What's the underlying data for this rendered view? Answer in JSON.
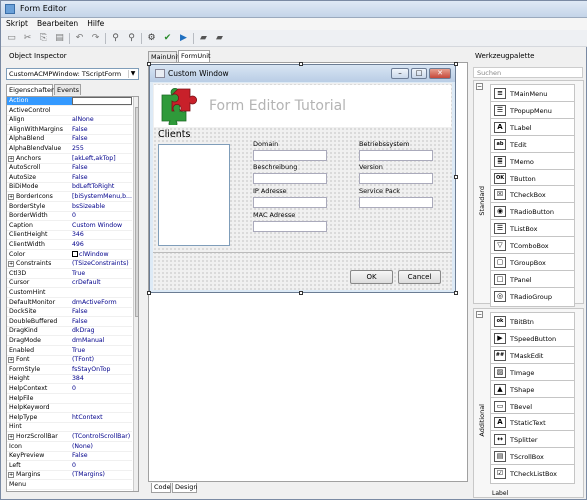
{
  "app": {
    "title": "Form Editor"
  },
  "menu": [
    "Skript",
    "Bearbeiten",
    "Hilfe"
  ],
  "toolbar_icons": [
    "new-icon",
    "cut-icon",
    "copy-icon",
    "paste-icon",
    "undo-icon",
    "redo-icon",
    "find-icon",
    "replace-icon",
    "compile-icon",
    "check-icon",
    "run-icon",
    "open-icon",
    "save-icon"
  ],
  "inspector": {
    "title": "Object Inspector",
    "combo": "CustomACMPWindow: TScriptForm",
    "tabs": [
      "Eigenschaften",
      "Events"
    ],
    "rows": [
      {
        "k": "Action",
        "v": "",
        "sel": true
      },
      {
        "k": "ActiveControl",
        "v": ""
      },
      {
        "k": "Align",
        "v": "alNone"
      },
      {
        "k": "AlignWithMargins",
        "v": "False"
      },
      {
        "k": "AlphaBlend",
        "v": "False"
      },
      {
        "k": "AlphaBlendValue",
        "v": "255"
      },
      {
        "k": "Anchors",
        "v": "[akLeft,akTop]",
        "plus": true
      },
      {
        "k": "AutoScroll",
        "v": "False"
      },
      {
        "k": "AutoSize",
        "v": "False"
      },
      {
        "k": "BiDiMode",
        "v": "bdLeftToRight"
      },
      {
        "k": "BorderIcons",
        "v": "[biSystemMenu,b...",
        "plus": true
      },
      {
        "k": "BorderStyle",
        "v": "bsSizeable"
      },
      {
        "k": "BorderWidth",
        "v": "0"
      },
      {
        "k": "Caption",
        "v": "Custom Window"
      },
      {
        "k": "ClientHeight",
        "v": "346"
      },
      {
        "k": "ClientWidth",
        "v": "496"
      },
      {
        "k": "Color",
        "v": "clWindow",
        "swatch": true
      },
      {
        "k": "Constraints",
        "v": "(TSizeConstraints)",
        "plus": true
      },
      {
        "k": "Ctl3D",
        "v": "True"
      },
      {
        "k": "Cursor",
        "v": "crDefault"
      },
      {
        "k": "CustomHint",
        "v": ""
      },
      {
        "k": "DefaultMonitor",
        "v": "dmActiveForm"
      },
      {
        "k": "DockSite",
        "v": "False"
      },
      {
        "k": "DoubleBuffered",
        "v": "False"
      },
      {
        "k": "DragKind",
        "v": "dkDrag"
      },
      {
        "k": "DragMode",
        "v": "dmManual"
      },
      {
        "k": "Enabled",
        "v": "True"
      },
      {
        "k": "Font",
        "v": "(TFont)",
        "plus": true
      },
      {
        "k": "FormStyle",
        "v": "fsStayOnTop"
      },
      {
        "k": "Height",
        "v": "384"
      },
      {
        "k": "HelpContext",
        "v": "0"
      },
      {
        "k": "HelpFile",
        "v": ""
      },
      {
        "k": "HelpKeyword",
        "v": ""
      },
      {
        "k": "HelpType",
        "v": "htContext"
      },
      {
        "k": "Hint",
        "v": ""
      },
      {
        "k": "HorzScrollBar",
        "v": "(TControlScrollBar)",
        "plus": true
      },
      {
        "k": "Icon",
        "v": "(None)"
      },
      {
        "k": "KeyPreview",
        "v": "False"
      },
      {
        "k": "Left",
        "v": "0"
      },
      {
        "k": "Margins",
        "v": "(TMargins)",
        "plus": true
      },
      {
        "k": "Menu",
        "v": ""
      }
    ]
  },
  "editor": {
    "tabs": [
      "MainUnit",
      "FormUnit"
    ],
    "bottom_tabs": [
      "Code",
      "Design"
    ],
    "form": {
      "caption": "Custom Window",
      "header_title": "Form Editor Tutorial",
      "clients_label": "Clients",
      "labels": {
        "domain": "Domain",
        "betriebssystem": "Betriebssystem",
        "beschreibung": "Beschreibung",
        "version": "Version",
        "ip": "IP Adresse",
        "servicepack": "Service Pack",
        "mac": "MAC Adresse"
      },
      "ok": "OK",
      "cancel": "Cancel",
      "buttons": {
        "min": "–",
        "max": "□",
        "close": "✕"
      }
    }
  },
  "palette": {
    "title": "Werkzeugpalette",
    "search_placeholder": "Suchen",
    "groups": [
      {
        "name": "Standard",
        "items": [
          "TMainMenu",
          "TPopupMenu",
          "TLabel",
          "TEdit",
          "TMemo",
          "TButton",
          "TCheckBox",
          "TRadioButton",
          "TListBox",
          "TComboBox",
          "TGroupBox",
          "TPanel",
          "TRadioGroup"
        ],
        "icons": [
          "main-menu-icon",
          "popup-menu-icon",
          "label-icon",
          "edit-icon",
          "memo-icon",
          "button-icon",
          "checkbox-icon",
          "radio-button-icon",
          "listbox-icon",
          "combobox-icon",
          "groupbox-icon",
          "panel-icon",
          "radio-group-icon"
        ],
        "glyphs": [
          "≡",
          "☰",
          "A",
          "ab",
          "≣",
          "OK",
          "☒",
          "◉",
          "☰",
          "▽",
          "▢",
          "□",
          "◎"
        ]
      },
      {
        "name": "Additional",
        "items": [
          "TBitBtn",
          "TSpeedButton",
          "TMaskEdit",
          "TImage",
          "TShape",
          "TBevel",
          "TStaticText",
          "TSplitter",
          "TScrollBox",
          "TCheckListBox"
        ],
        "icons": [
          "bitbtn-icon",
          "speed-button-icon",
          "mask-edit-icon",
          "image-icon",
          "shape-icon",
          "bevel-icon",
          "static-text-icon",
          "splitter-icon",
          "scrollbox-icon",
          "check-listbox-icon"
        ],
        "glyphs": [
          "ok",
          "▶",
          "##",
          "▨",
          "▲",
          "▭",
          "A",
          "↔",
          "▤",
          "☑"
        ]
      }
    ],
    "cutoff_label": "Label"
  },
  "colors": {
    "accent": "#3399ff",
    "titlebar": "#c4d4e8"
  }
}
